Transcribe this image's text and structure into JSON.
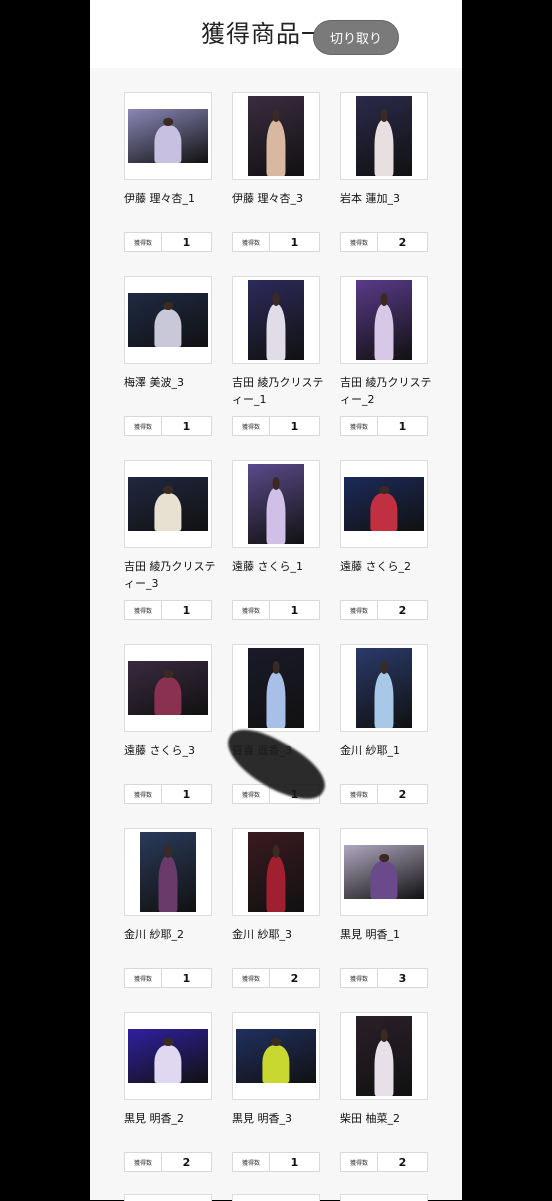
{
  "header": {
    "title": "獲得商品一覧",
    "crop_button": "切り取り"
  },
  "count_label": "獲得数",
  "items": [
    {
      "name": "伊藤 理々杏_1",
      "count": "1",
      "photo": "landscape",
      "bg": "#8a88b8",
      "accent": "#c8c0e0"
    },
    {
      "name": "伊藤 理々杏_3",
      "count": "1",
      "photo": "portrait",
      "bg": "#3a2c40",
      "accent": "#d8b8a0"
    },
    {
      "name": "岩本 蓮加_3",
      "count": "2",
      "photo": "portrait",
      "bg": "#2a2a4a",
      "accent": "#e8e0e0"
    },
    {
      "name": "梅澤 美波_3",
      "count": "1",
      "photo": "landscape",
      "bg": "#1e2a44",
      "accent": "#c8c8d8"
    },
    {
      "name": "吉田 綾乃クリスティー_1",
      "count": "1",
      "photo": "portrait",
      "bg": "#2c2a5a",
      "accent": "#e0dce8"
    },
    {
      "name": "吉田 綾乃クリスティー_2",
      "count": "1",
      "photo": "portrait",
      "bg": "#5a3a8a",
      "accent": "#d8c8e8"
    },
    {
      "name": "吉田 綾乃クリスティー_3",
      "count": "1",
      "photo": "landscape",
      "bg": "#202840",
      "accent": "#e8e0d0"
    },
    {
      "name": "遠藤 さくら_1",
      "count": "1",
      "photo": "portrait",
      "bg": "#5a4a8a",
      "accent": "#d0c0e8"
    },
    {
      "name": "遠藤 さくら_2",
      "count": "2",
      "photo": "landscape",
      "bg": "#1c2a5a",
      "accent": "#c03040"
    },
    {
      "name": "遠藤 さくら_3",
      "count": "1",
      "photo": "landscape",
      "bg": "#3a2a40",
      "accent": "#8a3050"
    },
    {
      "name": "賀喜 遥香_3",
      "count": "1",
      "photo": "portrait",
      "bg": "#1a1a2a",
      "accent": "#a8c0e8"
    },
    {
      "name": "金川 紗耶_1",
      "count": "2",
      "photo": "portrait",
      "bg": "#2a3a6a",
      "accent": "#a8c8e8"
    },
    {
      "name": "金川 紗耶_2",
      "count": "1",
      "photo": "portrait",
      "bg": "#2a3a5a",
      "accent": "#6a3a6a"
    },
    {
      "name": "金川 紗耶_3",
      "count": "2",
      "photo": "portrait",
      "bg": "#3a1a20",
      "accent": "#a02030"
    },
    {
      "name": "黒見 明香_1",
      "count": "3",
      "photo": "landscape",
      "bg": "#b0a8c0",
      "accent": "#6a4a8a"
    },
    {
      "name": "黒見 明香_2",
      "count": "2",
      "photo": "landscape",
      "bg": "#3020a0",
      "accent": "#e0d8f0"
    },
    {
      "name": "黒見 明香_3",
      "count": "1",
      "photo": "landscape",
      "bg": "#203060",
      "accent": "#c8d830"
    },
    {
      "name": "柴田 柚菜_2",
      "count": "2",
      "photo": "portrait",
      "bg": "#2a2028",
      "accent": "#e8e0e8"
    }
  ]
}
